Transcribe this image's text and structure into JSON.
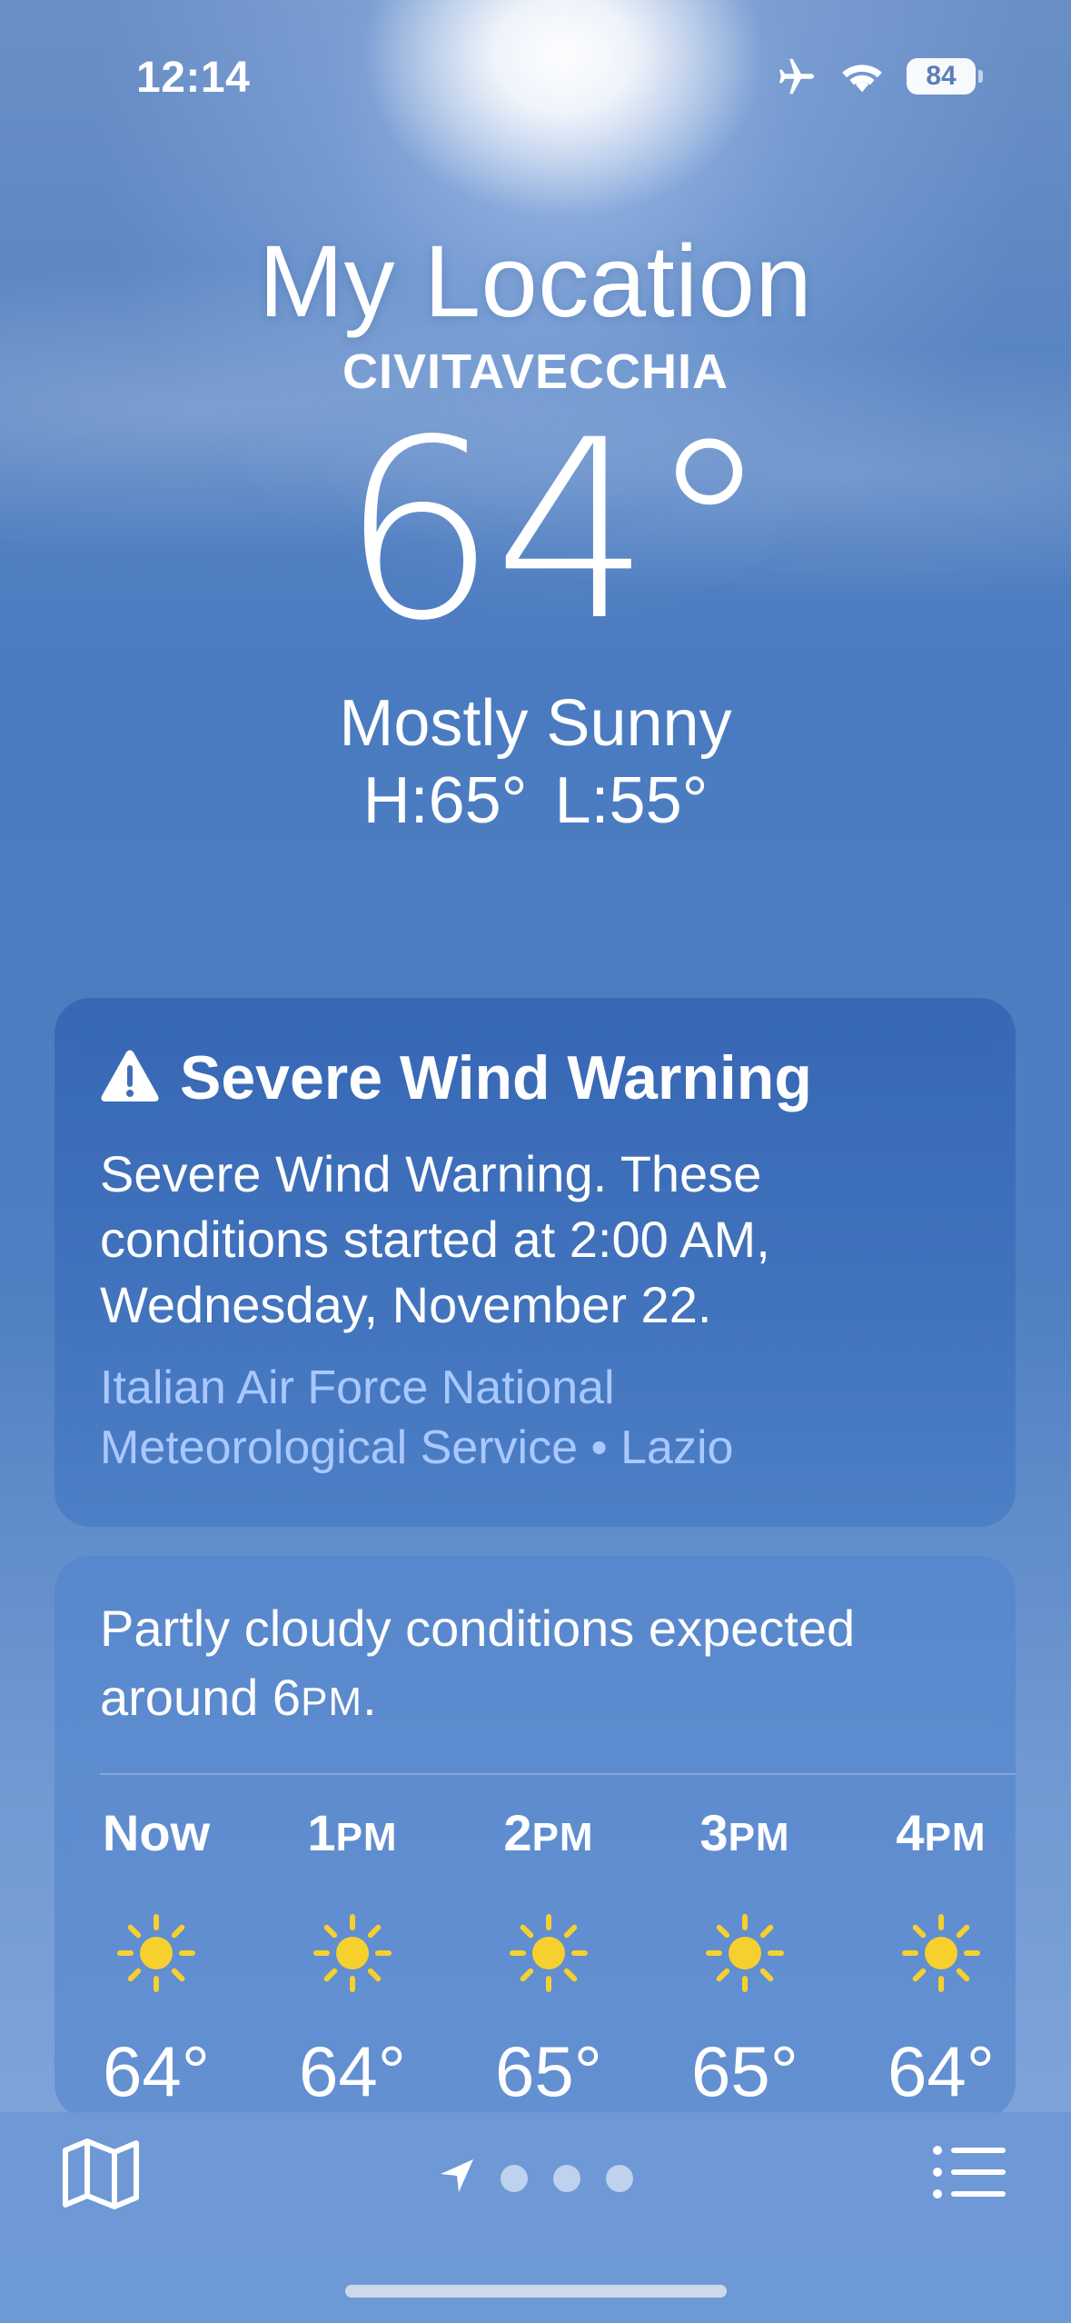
{
  "status_bar": {
    "time": "12:14",
    "battery": "84",
    "icons": [
      "airplane-icon",
      "wifi-icon",
      "battery-icon"
    ]
  },
  "header": {
    "title": "My Location",
    "city": "CIVITAVECCHIA",
    "temperature": "64°",
    "condition": "Mostly Sunny",
    "high_low": "H:65°  L:55°"
  },
  "alert": {
    "icon": "warning-triangle-icon",
    "title": "Severe Wind Warning",
    "body": "Severe Wind Warning. These conditions started at 2:00 AM, Wednesday, November 22.",
    "source": "Italian Air Force National Meteorological Service • Lazio"
  },
  "forecast": {
    "summary_prefix": "Partly cloudy conditions expected around 6",
    "summary_pm": "PM",
    "summary_suffix": ".",
    "hours": [
      {
        "num": "Now",
        "suffix": "",
        "icon": "sun-icon",
        "temp": "64°"
      },
      {
        "num": "1",
        "suffix": "PM",
        "icon": "sun-icon",
        "temp": "64°"
      },
      {
        "num": "2",
        "suffix": "PM",
        "icon": "sun-icon",
        "temp": "65°"
      },
      {
        "num": "3",
        "suffix": "PM",
        "icon": "sun-icon",
        "temp": "65°"
      },
      {
        "num": "4",
        "suffix": "PM",
        "icon": "sun-icon",
        "temp": "64°"
      }
    ]
  },
  "toolbar": {
    "left_icon": "map-icon",
    "right_icon": "list-icon",
    "pager_location_icon": "location-arrow-icon",
    "pager_dots": 3,
    "pager_selected": 0
  },
  "colors": {
    "sun": "#f6d02f",
    "alert_source": "#a9c8ff"
  }
}
